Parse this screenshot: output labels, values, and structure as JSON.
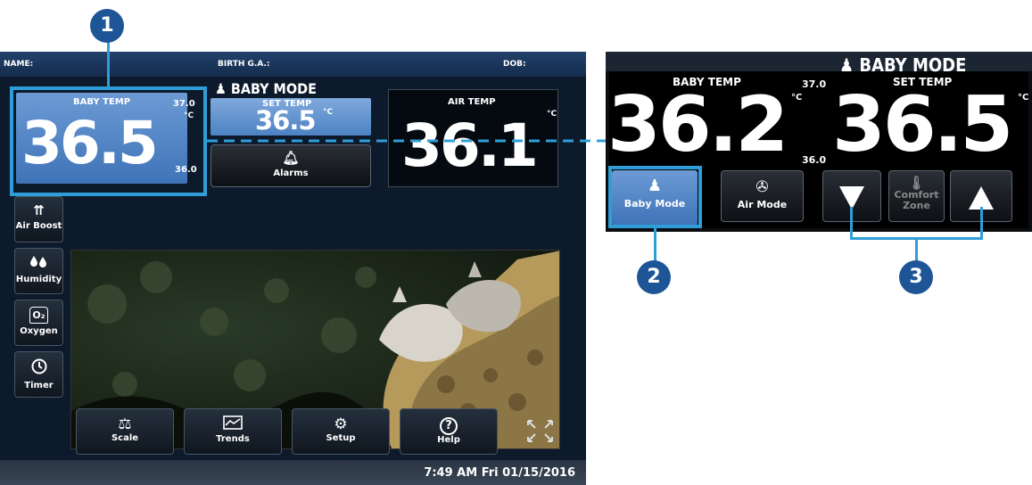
{
  "callouts": [
    "1",
    "2",
    "3"
  ],
  "patient_bar": {
    "name": "NAME:",
    "birth_ga": "BIRTH G.A.:",
    "dob": "DOB:"
  },
  "main": {
    "baby_temp_label": "BABY TEMP",
    "baby_temp_value": "36.5",
    "baby_temp_high": "37.0",
    "baby_temp_low": "36.0",
    "unit": "°C",
    "mode_title": "BABY MODE",
    "set_temp_label": "SET TEMP",
    "set_temp_value": "36.5",
    "air_temp_label": "AIR TEMP",
    "air_temp_value": "36.1",
    "alarms_label": "Alarms"
  },
  "side_buttons": [
    {
      "label": "Air Boost",
      "icon": "air-boost-icon",
      "glyph": "⇈"
    },
    {
      "label": "Humidity",
      "icon": "humidity-icon",
      "glyph": "💧"
    },
    {
      "label": "Oxygen",
      "icon": "oxygen-icon",
      "glyph": "O₂"
    },
    {
      "label": "Timer",
      "icon": "timer-icon",
      "glyph": "◷"
    }
  ],
  "bottom_buttons": [
    {
      "label": "Scale",
      "icon": "scale-icon",
      "glyph": "⚖"
    },
    {
      "label": "Trends",
      "icon": "trends-icon",
      "glyph": "⌇"
    },
    {
      "label": "Setup",
      "icon": "gears-icon",
      "glyph": "⚙"
    },
    {
      "label": "Help",
      "icon": "help-icon",
      "glyph": "?"
    }
  ],
  "status": {
    "clock": "7:49 AM Fri 01/15/2016"
  },
  "zoom": {
    "mode_title": "BABY MODE",
    "baby_temp_label": "BABY TEMP",
    "baby_temp_high": "37.0",
    "baby_temp_low": "36.0",
    "baby_temp_value": "36.2",
    "set_temp_label": "SET TEMP",
    "set_temp_value": "36.5",
    "unit": "°C",
    "baby_mode_label": "Baby Mode",
    "air_mode_label": "Air Mode",
    "comfort_zone_label_1": "Comfort",
    "comfort_zone_label_2": "Zone"
  },
  "colors": {
    "accent_blue": "#4a7fc2",
    "callout_blue": "#1d5597",
    "highlight_cyan": "#2f9ed8",
    "screen_bg": "#0d1a2b"
  }
}
